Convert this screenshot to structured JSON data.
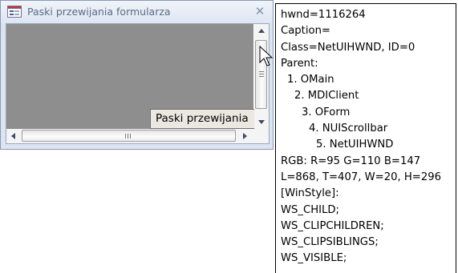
{
  "window": {
    "title": "Paski przewijania formularza",
    "close_glyph": "✕",
    "icon": "form-icon",
    "label_text": "Paski przewijania"
  },
  "info_panel": {
    "lines": [
      {
        "text": "hwnd=1116264",
        "indent": 0
      },
      {
        "text": "Caption=",
        "indent": 0
      },
      {
        "text": "Class=NetUIHWND, ID=0",
        "indent": 0
      },
      {
        "text": "Parent:",
        "indent": 0
      },
      {
        "text": "1. OMain",
        "indent": 1
      },
      {
        "text": "2. MDIClient",
        "indent": 2
      },
      {
        "text": "3. OForm",
        "indent": 3
      },
      {
        "text": "4. NUIScrollbar",
        "indent": 4
      },
      {
        "text": "5. NetUIHWND",
        "indent": 5
      },
      {
        "text": "RGB:  R=95 G=110 B=147",
        "indent": 0
      },
      {
        "text": "L=868, T=407, W=20, H=296",
        "indent": 0
      },
      {
        "text": "[WinStyle]:",
        "indent": 0
      },
      {
        "text": "WS_CHILD;",
        "indent": 0
      },
      {
        "text": "WS_CLIPCHILDREN;",
        "indent": 0
      },
      {
        "text": "WS_CLIPSIBLINGS;",
        "indent": 0
      },
      {
        "text": "WS_VISIBLE;",
        "indent": 0
      }
    ]
  },
  "colors": {
    "detail_background": "#8e8e8e",
    "titlebar_text": "#5a6a82",
    "scrollbar_arrow": "#3c4a66"
  }
}
